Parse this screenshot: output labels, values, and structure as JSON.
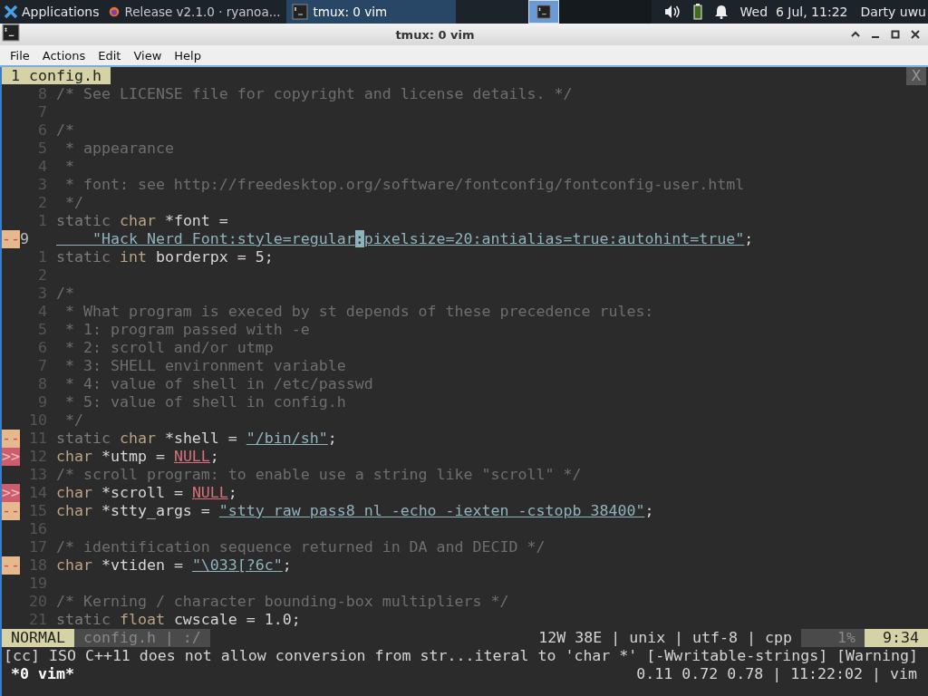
{
  "panel": {
    "menu_label": "Applications",
    "tasks": [
      {
        "kind": "browser",
        "label": "Release v2.1.0 · ryanoa...",
        "selected": false
      },
      {
        "kind": "terminal",
        "label": "tmux: 0 vim",
        "selected": true
      }
    ],
    "workspaces": [
      {
        "selected": true
      },
      {
        "selected": false
      },
      {
        "selected": false
      },
      {
        "selected": false
      }
    ],
    "clock": "Wed  6 Jul, 11:22",
    "user": "Darty uwu"
  },
  "window": {
    "title": "tmux: 0 vim"
  },
  "menu": [
    "File",
    "Actions",
    "Edit",
    "View",
    "Help"
  ],
  "vim": {
    "tabs": [
      {
        "label": "1 config.h",
        "selected": true
      }
    ],
    "close_label": "X",
    "lines": [
      {
        "number": "8",
        "segs": [
          {
            "kind": "comment",
            "text": "/* See LICENSE file for copyright and license details. */"
          }
        ]
      },
      {
        "number": "7"
      },
      {
        "number": "6",
        "segs": [
          {
            "kind": "comment",
            "text": "/*"
          }
        ]
      },
      {
        "number": "5",
        "segs": [
          {
            "kind": "comment",
            "text": " * appearance"
          }
        ]
      },
      {
        "number": "4",
        "segs": [
          {
            "kind": "comment",
            "text": " *"
          }
        ]
      },
      {
        "number": "3",
        "segs": [
          {
            "kind": "comment",
            "text": " * font: see http://freedesktop.org/software/fontconfig/fontconfig-user.html"
          }
        ]
      },
      {
        "number": "2",
        "segs": [
          {
            "kind": "comment",
            "text": " */"
          }
        ]
      },
      {
        "number": "1",
        "segs": [
          {
            "kind": "keyword",
            "text": "static "
          },
          {
            "kind": "type",
            "text": "char"
          },
          {
            "kind": "plain",
            "text": " *font ="
          }
        ]
      },
      {
        "number": "9",
        "current": true,
        "sign": {
          "text": "--",
          "kind": "warning"
        },
        "segs": [
          {
            "kind": "string",
            "text": "    \"Hack Nerd Font:style=regular"
          },
          {
            "kind": "cursor",
            "text": ":"
          },
          {
            "kind": "string",
            "text": "pixelsize=20:antialias=true:autohint=true\""
          },
          {
            "kind": "plain",
            "text": ";"
          }
        ]
      },
      {
        "number": "1",
        "segs": [
          {
            "kind": "keyword",
            "text": "static "
          },
          {
            "kind": "type",
            "text": "int"
          },
          {
            "kind": "plain",
            "text": " borderpx = 5;"
          }
        ]
      },
      {
        "number": "2"
      },
      {
        "number": "3",
        "segs": [
          {
            "kind": "comment",
            "text": "/*"
          }
        ]
      },
      {
        "number": "4",
        "segs": [
          {
            "kind": "comment",
            "text": " * What program is execed by st depends of these precedence rules:"
          }
        ]
      },
      {
        "number": "5",
        "segs": [
          {
            "kind": "comment",
            "text": " * 1: program passed with -e"
          }
        ]
      },
      {
        "number": "6",
        "segs": [
          {
            "kind": "comment",
            "text": " * 2: scroll and/or utmp"
          }
        ]
      },
      {
        "number": "7",
        "segs": [
          {
            "kind": "comment",
            "text": " * 3: SHELL environment variable"
          }
        ]
      },
      {
        "number": "8",
        "segs": [
          {
            "kind": "comment",
            "text": " * 4: value of shell in /etc/passwd"
          }
        ]
      },
      {
        "number": "9",
        "segs": [
          {
            "kind": "comment",
            "text": " * 5: value of shell in config.h"
          }
        ]
      },
      {
        "number": "10",
        "segs": [
          {
            "kind": "comment",
            "text": " */"
          }
        ]
      },
      {
        "number": "11",
        "sign": {
          "text": "--",
          "kind": "warning"
        },
        "segs": [
          {
            "kind": "keyword",
            "text": "static "
          },
          {
            "kind": "type",
            "text": "char"
          },
          {
            "kind": "plain",
            "text": " *shell = "
          },
          {
            "kind": "string",
            "text": "\"/bin/sh\""
          },
          {
            "kind": "plain",
            "text": ";"
          }
        ]
      },
      {
        "number": "12",
        "sign": {
          "text": ">>",
          "kind": "error"
        },
        "segs": [
          {
            "kind": "type",
            "text": "char"
          },
          {
            "kind": "plain",
            "text": " *utmp = "
          },
          {
            "kind": "constant",
            "text": "NULL"
          },
          {
            "kind": "plain",
            "text": ";"
          }
        ]
      },
      {
        "number": "13",
        "segs": [
          {
            "kind": "comment",
            "text": "/* scroll program: to enable use a string like \"scroll\" */"
          }
        ]
      },
      {
        "number": "14",
        "sign": {
          "text": ">>",
          "kind": "error"
        },
        "segs": [
          {
            "kind": "type",
            "text": "char"
          },
          {
            "kind": "plain",
            "text": " *scroll = "
          },
          {
            "kind": "constant",
            "text": "NULL"
          },
          {
            "kind": "plain",
            "text": ";"
          }
        ]
      },
      {
        "number": "15",
        "sign": {
          "text": "--",
          "kind": "warning"
        },
        "segs": [
          {
            "kind": "type",
            "text": "char"
          },
          {
            "kind": "plain",
            "text": " *stty_args = "
          },
          {
            "kind": "string",
            "text": "\"stty raw pass8 nl -echo -iexten -cstopb 38400\""
          },
          {
            "kind": "plain",
            "text": ";"
          }
        ]
      },
      {
        "number": "16"
      },
      {
        "number": "17",
        "segs": [
          {
            "kind": "comment",
            "text": "/* identification sequence returned in DA and DECID */"
          }
        ]
      },
      {
        "number": "18",
        "sign": {
          "text": "--",
          "kind": "warning"
        },
        "segs": [
          {
            "kind": "type",
            "text": "char"
          },
          {
            "kind": "plain",
            "text": " *vtiden = "
          },
          {
            "kind": "string",
            "text": "\"\\033[?6c\""
          },
          {
            "kind": "plain",
            "text": ";"
          }
        ]
      },
      {
        "number": "19"
      },
      {
        "number": "20",
        "segs": [
          {
            "kind": "comment",
            "text": "/* Kerning / character bounding-box multipliers */"
          }
        ]
      },
      {
        "number": "21",
        "segs": [
          {
            "kind": "keyword",
            "text": "static "
          },
          {
            "kind": "type",
            "text": "float"
          },
          {
            "kind": "plain",
            "text": " cwscale = 1.0;"
          }
        ]
      }
    ],
    "status": {
      "mode": "NORMAL",
      "file": "config.h | :/",
      "info": "12W 38E | unix | utf-8 | cpp",
      "percent": "1%",
      "position": "9:34"
    },
    "message": "[cc] ISO C++11 does not allow conversion from str...iteral to 'char *' [-Wwritable-strings] [Warning]"
  },
  "tmux": {
    "window_label": " *0 vim*",
    "right": "0.11 0.72 0.78 | 11:22:02 | vim"
  }
}
